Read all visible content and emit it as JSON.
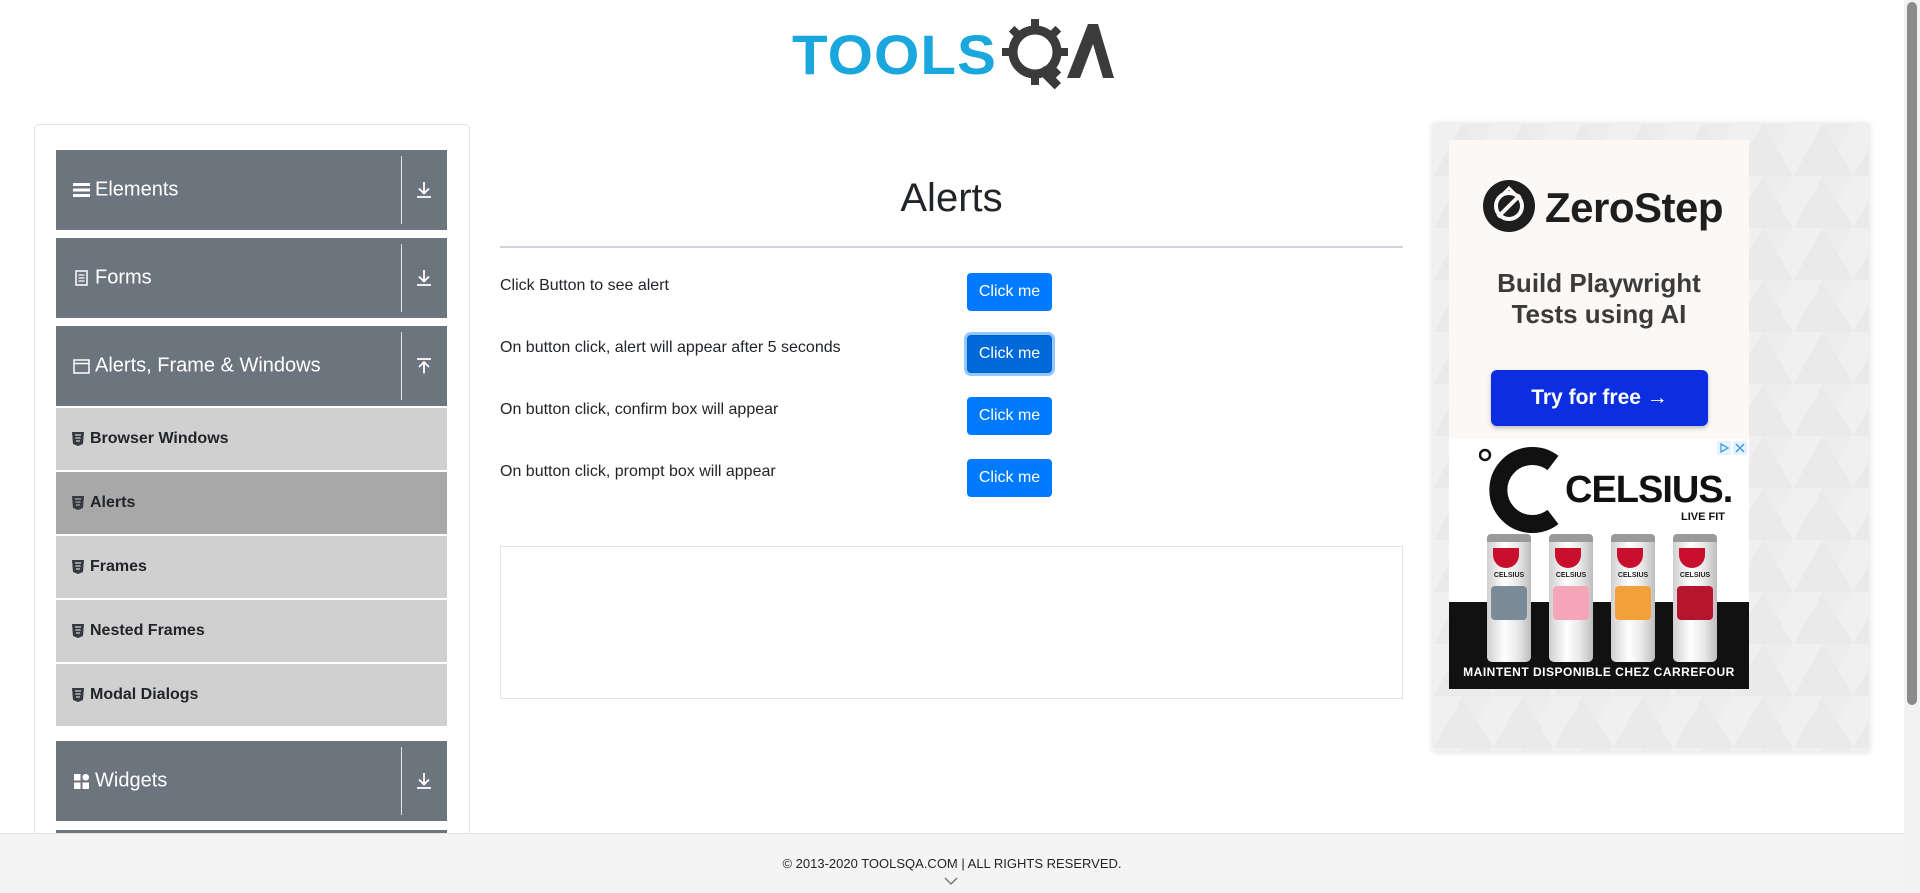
{
  "header": {
    "logo_text": "TOOLSQA"
  },
  "sidebar": {
    "groups": [
      {
        "label": "Elements",
        "icon": "hamburger-icon",
        "state": "collapsed"
      },
      {
        "label": "Forms",
        "icon": "document-icon",
        "state": "collapsed"
      },
      {
        "label": "Alerts, Frame & Windows",
        "icon": "window-icon",
        "state": "expanded"
      },
      {
        "label": "Widgets",
        "icon": "grid-icon",
        "state": "collapsed"
      }
    ],
    "items": [
      {
        "label": "Browser Windows"
      },
      {
        "label": "Alerts",
        "active": true
      },
      {
        "label": "Frames"
      },
      {
        "label": "Nested Frames"
      },
      {
        "label": "Modal Dialogs"
      }
    ]
  },
  "main": {
    "title": "Alerts",
    "rows": [
      {
        "text": "Click Button to see alert",
        "button": "Click me"
      },
      {
        "text": "On button click, alert will appear after 5 seconds",
        "button": "Click me",
        "focused": true
      },
      {
        "text": "On button click, confirm box will appear",
        "button": "Click me"
      },
      {
        "text": "On button click, prompt box will appear",
        "button": "Click me"
      }
    ]
  },
  "ads": {
    "zerostep": {
      "brand": "ZeroStep",
      "tagline_line1": "Build Playwright",
      "tagline_line2": "Tests using AI",
      "cta": "Try for free →"
    },
    "celsius": {
      "brand": "CELSIUS.",
      "sub": "LIVE FIT",
      "footer": "MAINTENT DISPONIBLE CHEZ CARREFOUR"
    }
  },
  "footer": {
    "text": "© 2013-2020 TOOLSQA.COM | ALL RIGHTS RESERVED."
  },
  "colors": {
    "sidebar_header": "#6c757d",
    "sidebar_item": "#d0d0d0",
    "sidebar_item_active": "#a8a8a8",
    "primary_button": "#007bff",
    "logo_blue": "#1aa7dd",
    "logo_dark": "#3b3b3b"
  }
}
